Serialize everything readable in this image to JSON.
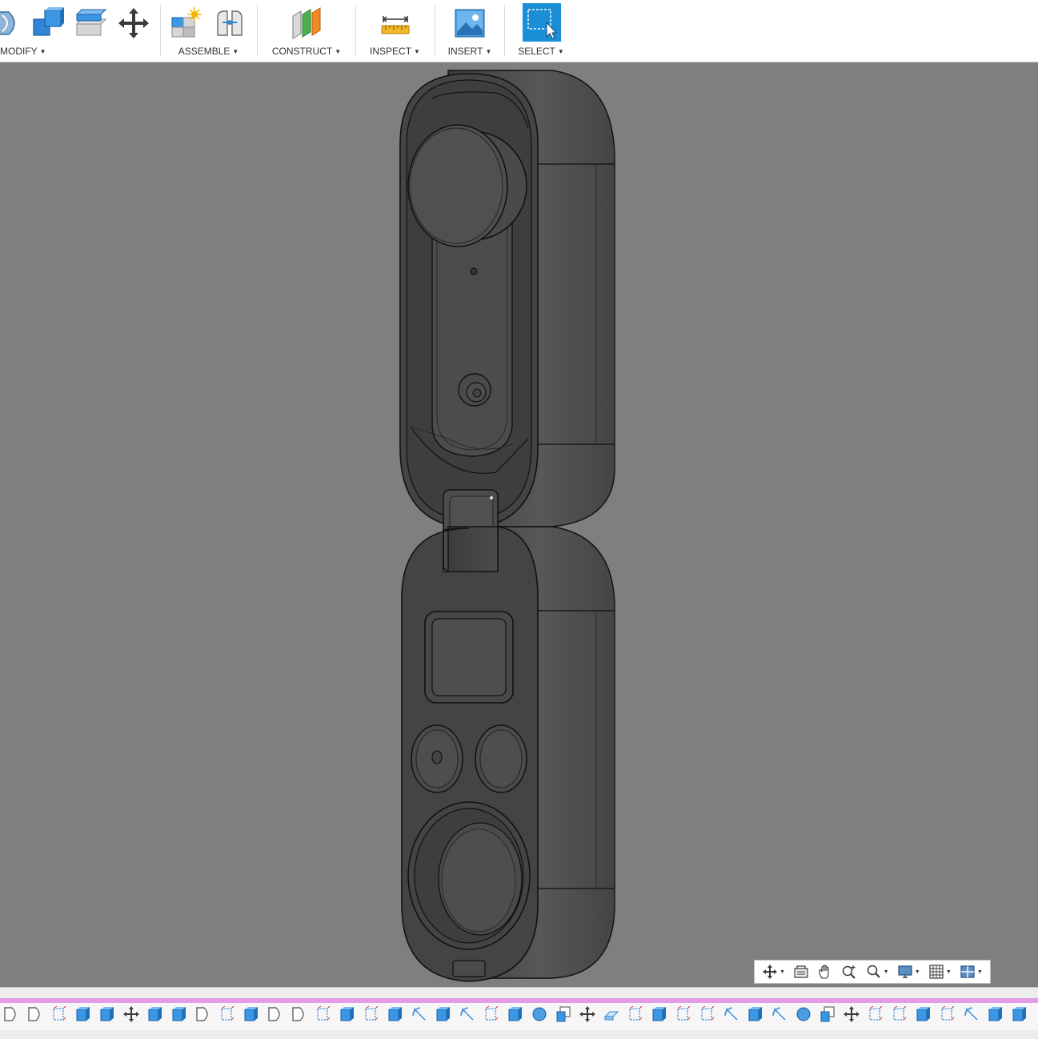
{
  "toolbar": {
    "groups": [
      {
        "label": "MODIFY",
        "icons": [
          "press-pull-icon",
          "combine-icon",
          "offset-face-icon",
          "move-icon"
        ]
      },
      {
        "label": "ASSEMBLE",
        "icons": [
          "new-component-icon",
          "joint-icon"
        ]
      },
      {
        "label": "CONSTRUCT",
        "icons": [
          "offset-plane-icon"
        ]
      },
      {
        "label": "INSPECT",
        "icons": [
          "measure-icon"
        ]
      },
      {
        "label": "INSERT",
        "icons": [
          "insert-image-icon"
        ]
      },
      {
        "label": "SELECT",
        "icons": [
          "select-window-icon"
        ]
      }
    ]
  },
  "navbar": {
    "tools": [
      "orbit-icon",
      "look-at-icon",
      "pan-icon",
      "zoom-icon",
      "fit-icon",
      "display-settings-icon",
      "grid-icon",
      "viewports-icon"
    ]
  },
  "timeline": {
    "feature_count": 43
  },
  "colors": {
    "viewport_bg": "#7f7f7f",
    "toolbar_bg": "#ffffff",
    "select_accent": "#1a8fd6",
    "timeline_track": "#e59ce8",
    "model_body": "#4a4a4a",
    "model_edge": "#111111"
  }
}
